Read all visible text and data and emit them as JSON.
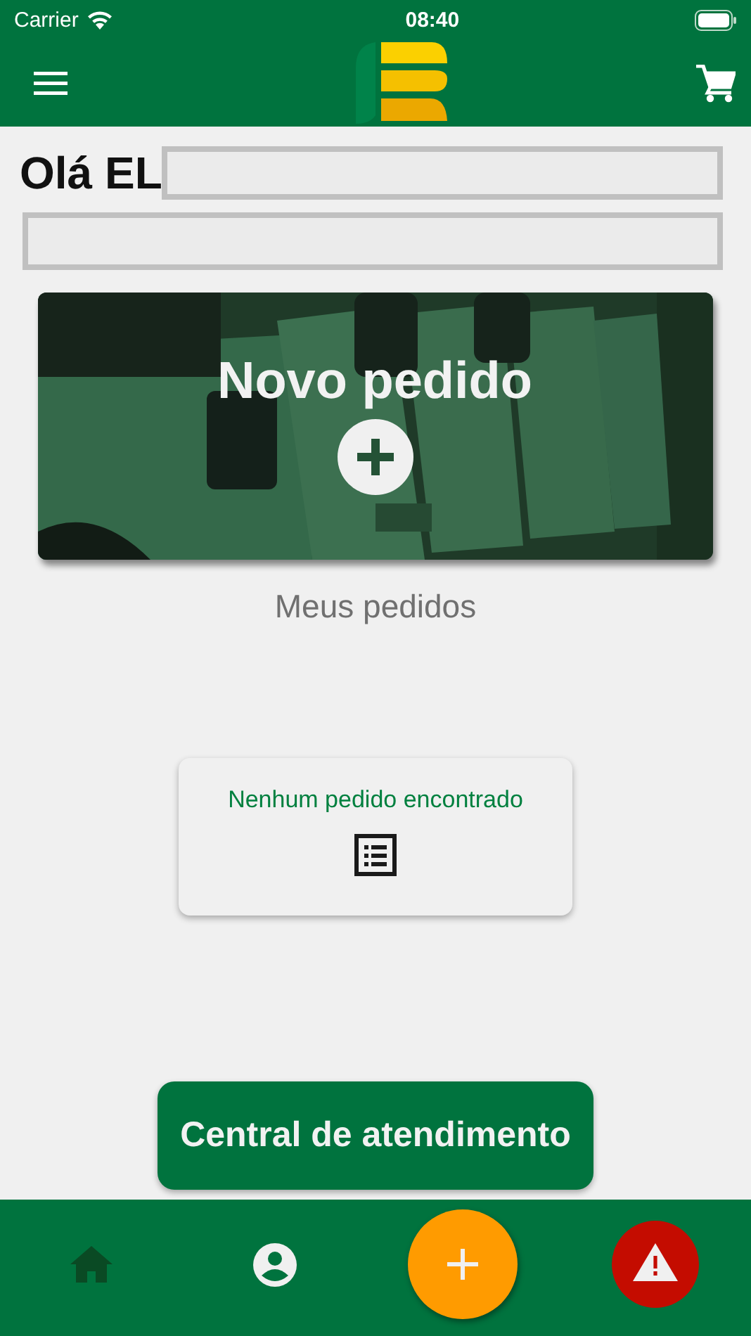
{
  "status_bar": {
    "carrier": "Carrier",
    "time": "08:40"
  },
  "greeting": {
    "text": "Olá EL"
  },
  "new_order_card": {
    "title": "Novo pedido"
  },
  "orders": {
    "title": "Meus pedidos",
    "empty_message": "Nenhum pedido encontrado"
  },
  "support_button": {
    "label": "Central de atendimento"
  },
  "bottom_nav": [
    {
      "kind": "home",
      "selected": true
    },
    {
      "kind": "profile",
      "selected": false
    },
    {
      "kind": "add",
      "selected": false
    },
    {
      "kind": "alert",
      "selected": false
    }
  ]
}
